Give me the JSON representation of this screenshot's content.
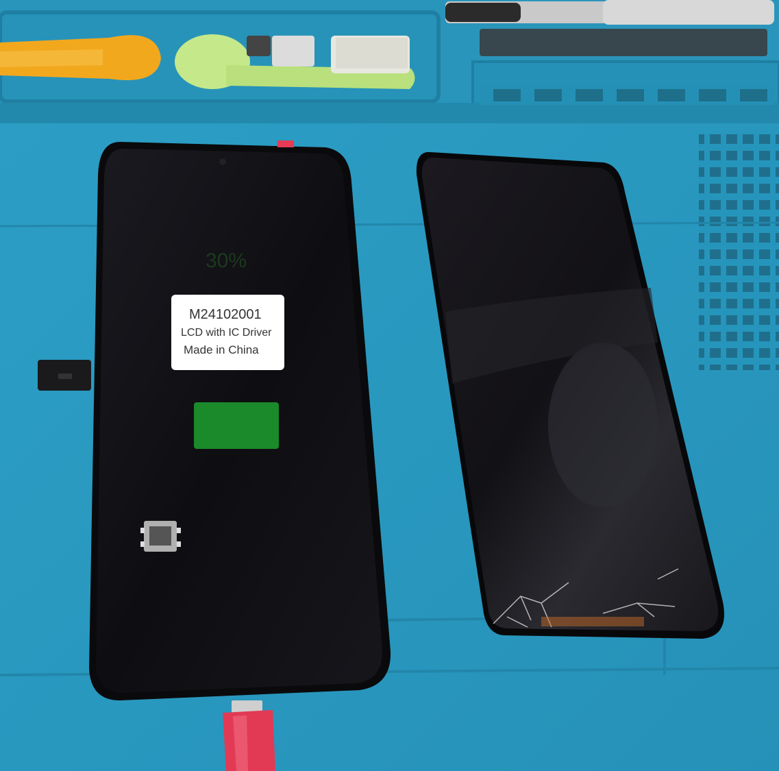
{
  "photo": {
    "subject": "Two smartphone display assemblies on a blue repair mat",
    "colors": {
      "mat": "#2a9cc4",
      "mat_dark": "#1f86ab",
      "phone_body": "#0b0b0e",
      "screen_glass": "#121216",
      "charge_indicator": "#1a8a2a",
      "cable": "#e23a55",
      "label_bg": "#ffffff"
    }
  },
  "new_screen": {
    "label": {
      "line1": "M24102001",
      "line2": "LCD with IC Driver",
      "line3": "Made in China"
    },
    "charge_percent_text": "30%"
  },
  "old_screen": {
    "condition": "cracked glass at bottom edge"
  }
}
